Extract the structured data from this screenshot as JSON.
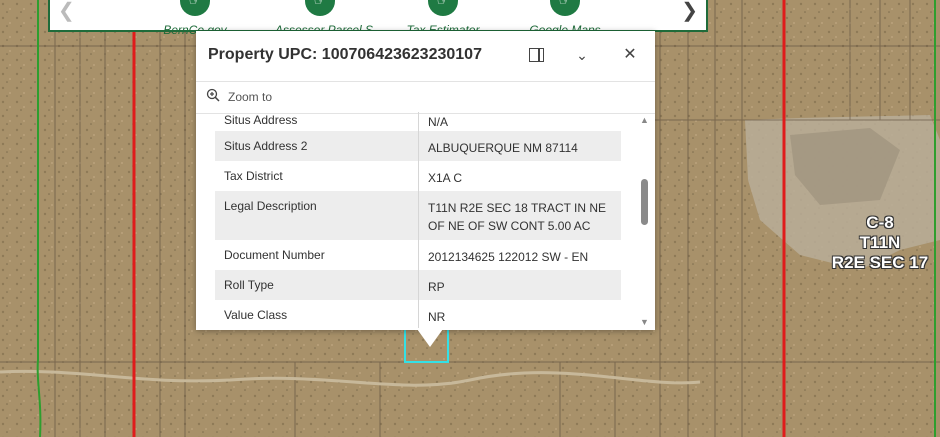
{
  "toolbar": {
    "items": [
      {
        "label": "BernCo.gov"
      },
      {
        "label": "Assessor Parcel S..."
      },
      {
        "label": "Tax Estimator"
      },
      {
        "label": "Google Maps"
      }
    ],
    "prev_icon": "chevron-left-icon",
    "next_icon": "chevron-right-icon"
  },
  "popup": {
    "title": "Property UPC: 100706423623230107",
    "zoom_label": "Zoom to",
    "rows": [
      {
        "key": "Situs Address",
        "value": "N/A"
      },
      {
        "key": "Situs Address 2",
        "value": "ALBUQUERQUE NM 87114"
      },
      {
        "key": "Tax District",
        "value": "X1A C"
      },
      {
        "key": "Legal Description",
        "value": "T11N R2E SEC 18 TRACT IN NE OF NE OF SW CONT 5.00 AC"
      },
      {
        "key": "Document Number",
        "value": "2012134625 122012 SW - EN"
      },
      {
        "key": "Roll Type",
        "value": "RP"
      },
      {
        "key": "Value Class",
        "value": "NR"
      }
    ]
  },
  "map": {
    "section_label_lines": [
      "C-8",
      "T11N",
      "R2E SEC 17"
    ],
    "colors": {
      "section_line": "#e01b1b",
      "road_line": "#2e9e2e",
      "parcel_line": "#5a4a3a",
      "selected_parcel": "#33e0e6",
      "terrain": "#a8916a"
    }
  }
}
